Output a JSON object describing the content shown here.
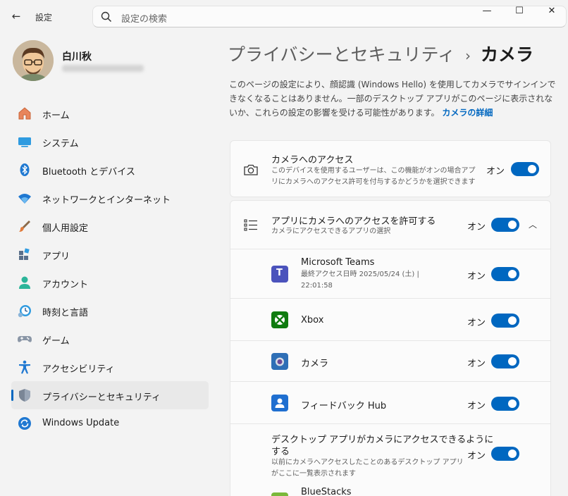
{
  "window": {
    "title": "設定",
    "minimize": "—",
    "maximize": "☐",
    "close": "✕"
  },
  "search": {
    "placeholder": "設定の検索"
  },
  "user": {
    "name": "白川秋"
  },
  "sidebar": {
    "items": [
      {
        "label": "ホーム",
        "icon": "home-icon"
      },
      {
        "label": "システム",
        "icon": "system-icon"
      },
      {
        "label": "Bluetooth とデバイス",
        "icon": "bluetooth-icon"
      },
      {
        "label": "ネットワークとインターネット",
        "icon": "network-icon"
      },
      {
        "label": "個人用設定",
        "icon": "brush-icon"
      },
      {
        "label": "アプリ",
        "icon": "apps-icon"
      },
      {
        "label": "アカウント",
        "icon": "account-icon"
      },
      {
        "label": "時刻と言語",
        "icon": "clock-language-icon"
      },
      {
        "label": "ゲーム",
        "icon": "gamepad-icon"
      },
      {
        "label": "アクセシビリティ",
        "icon": "accessibility-icon"
      },
      {
        "label": "プライバシーとセキュリティ",
        "icon": "shield-icon",
        "active": true
      },
      {
        "label": "Windows Update",
        "icon": "windows-update-icon"
      }
    ]
  },
  "header": {
    "parent": "プライバシーとセキュリティ",
    "separator": "›",
    "current": "カメラ"
  },
  "description": {
    "text": "このページの設定により、顔認識 (Windows Hello) を使用してカメラでサインインできなくなることはありません。一部のデスクトップ アプリがこのページに表示されないか、これらの設定の影響を受ける可能性があります。",
    "link": "カメラの詳細"
  },
  "camera_access": {
    "title": "カメラへのアクセス",
    "subtitle": "このデバイスを使用するユーザーは、この機能がオンの場合アプリにカメラへのアクセス許可を付与するかどうかを選択できます",
    "state": "オン"
  },
  "app_access": {
    "title": "アプリにカメラへのアクセスを許可する",
    "subtitle": "カメラにアクセスできるアプリの選択",
    "state": "オン",
    "apps": [
      {
        "name": "Microsoft Teams",
        "detail_1": "最終アクセス日時 2025/05/24 (土) |",
        "detail_2": "22:01:58",
        "state": "オン",
        "icon": "teams-icon",
        "color": "#4b53bc"
      },
      {
        "name": "Xbox",
        "state": "オン",
        "icon": "xbox-icon",
        "color": "#107c10"
      },
      {
        "name": "カメラ",
        "state": "オン",
        "icon": "camera-app-icon",
        "color": "#2f6fb6"
      },
      {
        "name": "フィードバック Hub",
        "state": "オン",
        "icon": "feedback-hub-icon",
        "color": "#1f6fd0"
      }
    ],
    "desktop": {
      "title_1": "デスクトップ アプリがカメラにアクセスできるように",
      "title_2": "する",
      "subtitle_1": "以前にカメラへアクセスしたことのあるデスクトップ アプリ",
      "subtitle_2": "がここに一覧表示されます",
      "state": "オン"
    },
    "partial_app": "BlueStacks"
  }
}
